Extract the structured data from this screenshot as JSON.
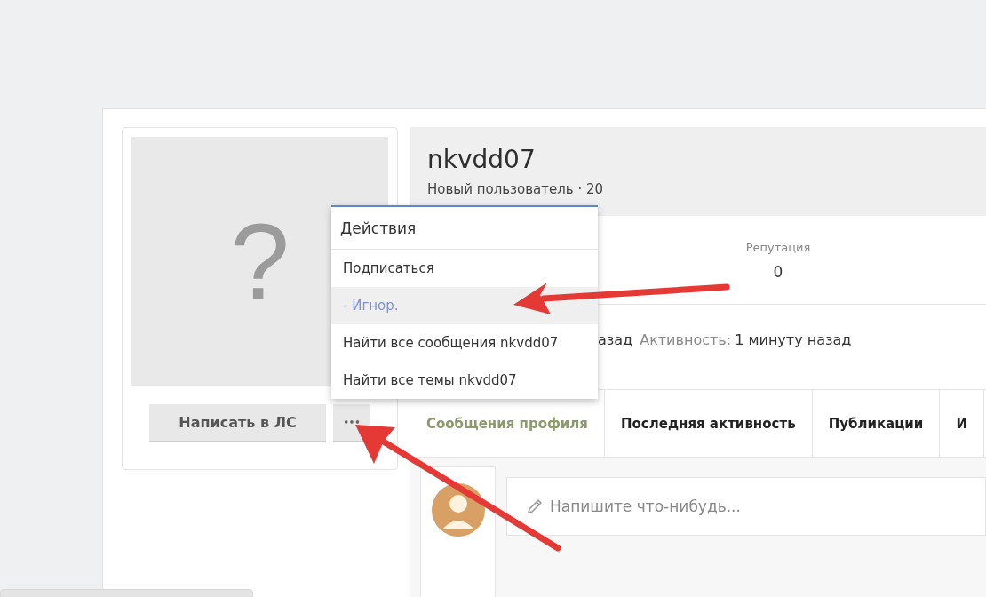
{
  "profile_card": {
    "avatar_placeholder": "?",
    "buttons": [
      {
        "label": "Написать в ЛС",
        "kind": "message"
      },
      {
        "label": "•••",
        "kind": "more"
      }
    ]
  },
  "header": {
    "username": "nkvdd07",
    "subtitle": "Новый пользователь · 20"
  },
  "stats": [
    {
      "label": "Репутация",
      "value": "0"
    }
  ],
  "info_line": {
    "fragment": "азад",
    "label": "Активность:",
    "value": "1 минуту назад"
  },
  "tabs": [
    {
      "label": "Сообщения профиля",
      "selected": true
    },
    {
      "label": "Последняя активность",
      "selected": false
    },
    {
      "label": "Публикации",
      "selected": false
    },
    {
      "label": "И",
      "selected": false
    }
  ],
  "profile_posts": {
    "placeholder": "Напишите что-нибудь..."
  },
  "actions_menu": {
    "title": "Действия",
    "items": [
      {
        "label": "Подписаться",
        "selected": false
      },
      {
        "label": "- Игнор.",
        "selected": true
      },
      {
        "label": "Найти все сообщения nkvdd07",
        "selected": false
      },
      {
        "label": "Найти все темы nkvdd07",
        "selected": false
      }
    ]
  }
}
